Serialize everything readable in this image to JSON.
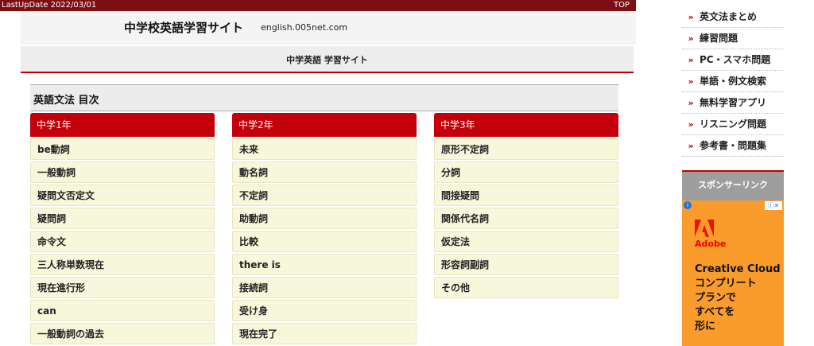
{
  "topbar": {
    "update": "LastUpDate 2022/03/01",
    "top_link": "TOP"
  },
  "header": {
    "title": "中学校英語学習サイト",
    "domain": "english.005net.com"
  },
  "navbar": {
    "title": "中学英語 学習サイト"
  },
  "section": {
    "heading": "英語文法 目次"
  },
  "columns": [
    {
      "header": "中学1年",
      "items": [
        "be動詞",
        "一般動詞",
        "疑問文否定文",
        "疑問詞",
        "命令文",
        "三人称単数現在",
        "現在進行形",
        "can",
        "一般動詞の過去"
      ]
    },
    {
      "header": "中学2年",
      "items": [
        "未来",
        "動名詞",
        "不定詞",
        "助動詞",
        "比較",
        "there is",
        "接続詞",
        "受け身",
        "現在完了"
      ]
    },
    {
      "header": "中学3年",
      "items": [
        "原形不定詞",
        "分詞",
        "間接疑問",
        "関係代名詞",
        "仮定法",
        "形容詞副詞",
        "その他"
      ]
    }
  ],
  "sidebar": {
    "arrow": "»",
    "items": [
      "英文法まとめ",
      "練習問題",
      "PC・スマホ問題",
      "単語・例文検索",
      "無料学習アプリ",
      "リスニング問題",
      "参考書・問題集"
    ],
    "sponsor": "スポンサーリンク"
  },
  "ad": {
    "brand": "Adobe",
    "lines": [
      "Creative Cloud",
      "コンプリート",
      "プランで",
      "すべてを",
      "形に"
    ],
    "info_icon": "info-icon",
    "close_label": "ⓘ✕",
    "colors": {
      "background": "#f99c2c",
      "logo": "#ee1111"
    }
  },
  "colors": {
    "accent": "#c4000a",
    "topbar": "#7c0f14",
    "item_bg": "#f7f7dc"
  }
}
